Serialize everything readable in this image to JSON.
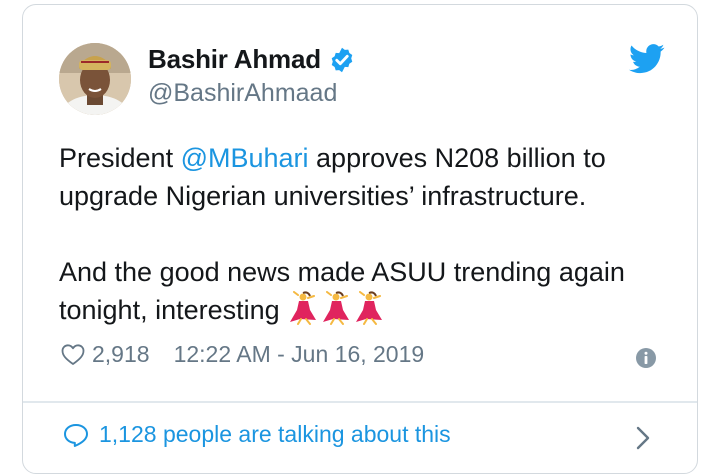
{
  "author": {
    "name": "Bashir Ahmad",
    "handle": "@BashirAhmaad",
    "verified": true,
    "avatar_icon": "profile-photo"
  },
  "tweet": {
    "line1_prefix": "President ",
    "mention": "@MBuhari",
    "line1_suffix": " approves N208 billion to upgrade Nigerian universities’ infrastructure.",
    "line2": "And the good news made ASUU trending again tonight, interesting",
    "emoji": [
      "dancing-woman-emoji",
      "dancing-woman-emoji",
      "dancing-woman-emoji"
    ]
  },
  "meta": {
    "likes": "2,918",
    "timestamp": "12:22 AM - Jun 16, 2019"
  },
  "footer": {
    "talking_text": "1,128 people are talking about this"
  },
  "icons": {
    "brand": "twitter-bird-icon",
    "verified": "verified-badge-icon",
    "like": "heart-icon",
    "info": "info-icon",
    "conversation": "speech-bubble-icon",
    "more": "chevron-right-icon"
  },
  "colors": {
    "twitter_blue": "#1da1f2",
    "link_blue": "#1b95e0",
    "text": "#14171a",
    "secondary": "#657786",
    "border": "#d3d9de"
  }
}
